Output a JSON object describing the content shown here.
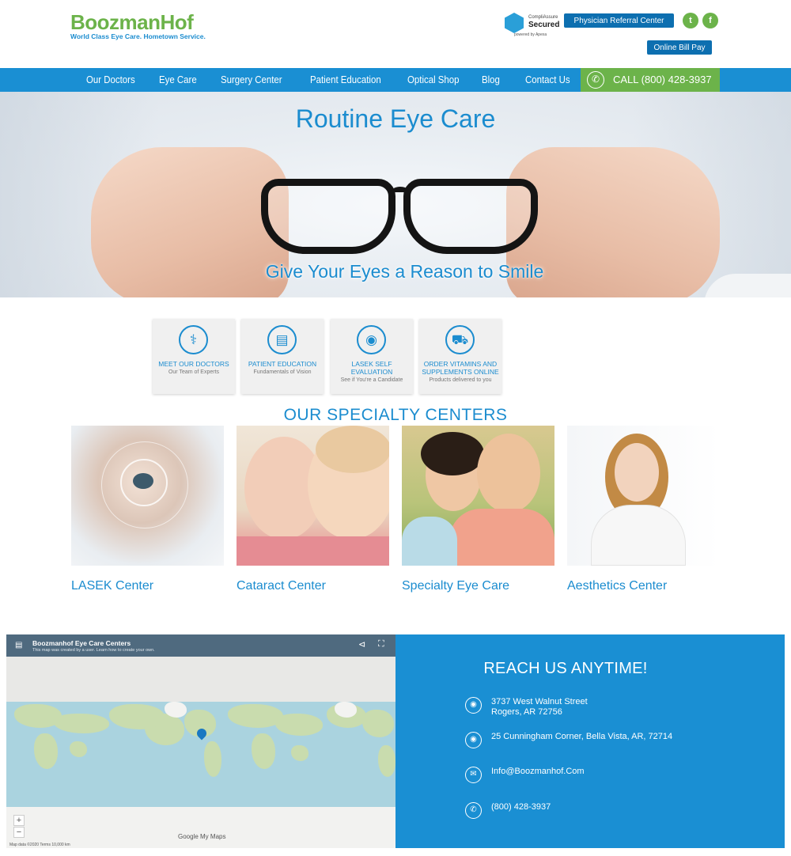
{
  "header": {
    "logo": "BoozmanHof",
    "tagline": "World Class Eye Care. Hometown Service.",
    "compliassure": {
      "top": "CompliAssure",
      "middle": "Secured",
      "bottom": "powered by Apexa"
    },
    "physician_referral_label": "Physician Referral Center",
    "online_bill_pay_label": "Online Bill Pay",
    "social": [
      "twitter-icon",
      "facebook-icon"
    ]
  },
  "nav": {
    "items": [
      "Our Doctors",
      "Eye Care",
      "Surgery Center",
      "Patient Education",
      "Optical Shop",
      "Blog",
      "Contact Us"
    ],
    "call_label": "CALL (800) 428-3937"
  },
  "hero": {
    "title": "Routine Eye Care",
    "subtitle": "Give Your Eyes a Reason to Smile"
  },
  "features": [
    {
      "title": "MEET OUR DOCTORS",
      "subtitle": "Our Team of Experts",
      "icon": "stethoscope-icon"
    },
    {
      "title": "PATIENT EDUCATION",
      "subtitle": "Fundamentals of Vision",
      "icon": "presentation-icon"
    },
    {
      "title": "LASEK SELF EVALUATION",
      "subtitle": "See if You're a Candidate",
      "icon": "eye-icon"
    },
    {
      "title": "ORDER VITAMINS AND SUPPLEMENTS ONLINE",
      "subtitle": "Products delivered to you",
      "icon": "truck-icon"
    }
  ],
  "specialty": {
    "heading": "OUR SPECIALTY CENTERS",
    "centers": [
      "LASEK Center",
      "Cataract Center",
      "Specialty Eye Care",
      "Aesthetics Center"
    ]
  },
  "map": {
    "title": "Boozmanhof Eye Care Centers",
    "subtitle": "This map was created by a user. Learn how to create your own.",
    "zoom_in": "+",
    "zoom_out": "−",
    "google_label": "Google My Maps",
    "footer": "Map data ©2020   Terms   10,000 km"
  },
  "reach": {
    "title": "REACH US ANYTIME!",
    "address1_line1": "3737 West Walnut Street",
    "address1_line2": "Rogers, AR 72756",
    "address2": "25 Cunningham Corner, Bella Vista, AR, 72714",
    "email": "Info@Boozmanhof.Com",
    "phone": "(800) 428-3937"
  },
  "colors": {
    "brand_blue": "#1a8fd3",
    "brand_green": "#6cb34a",
    "dark_blue": "#0d6fb0"
  }
}
